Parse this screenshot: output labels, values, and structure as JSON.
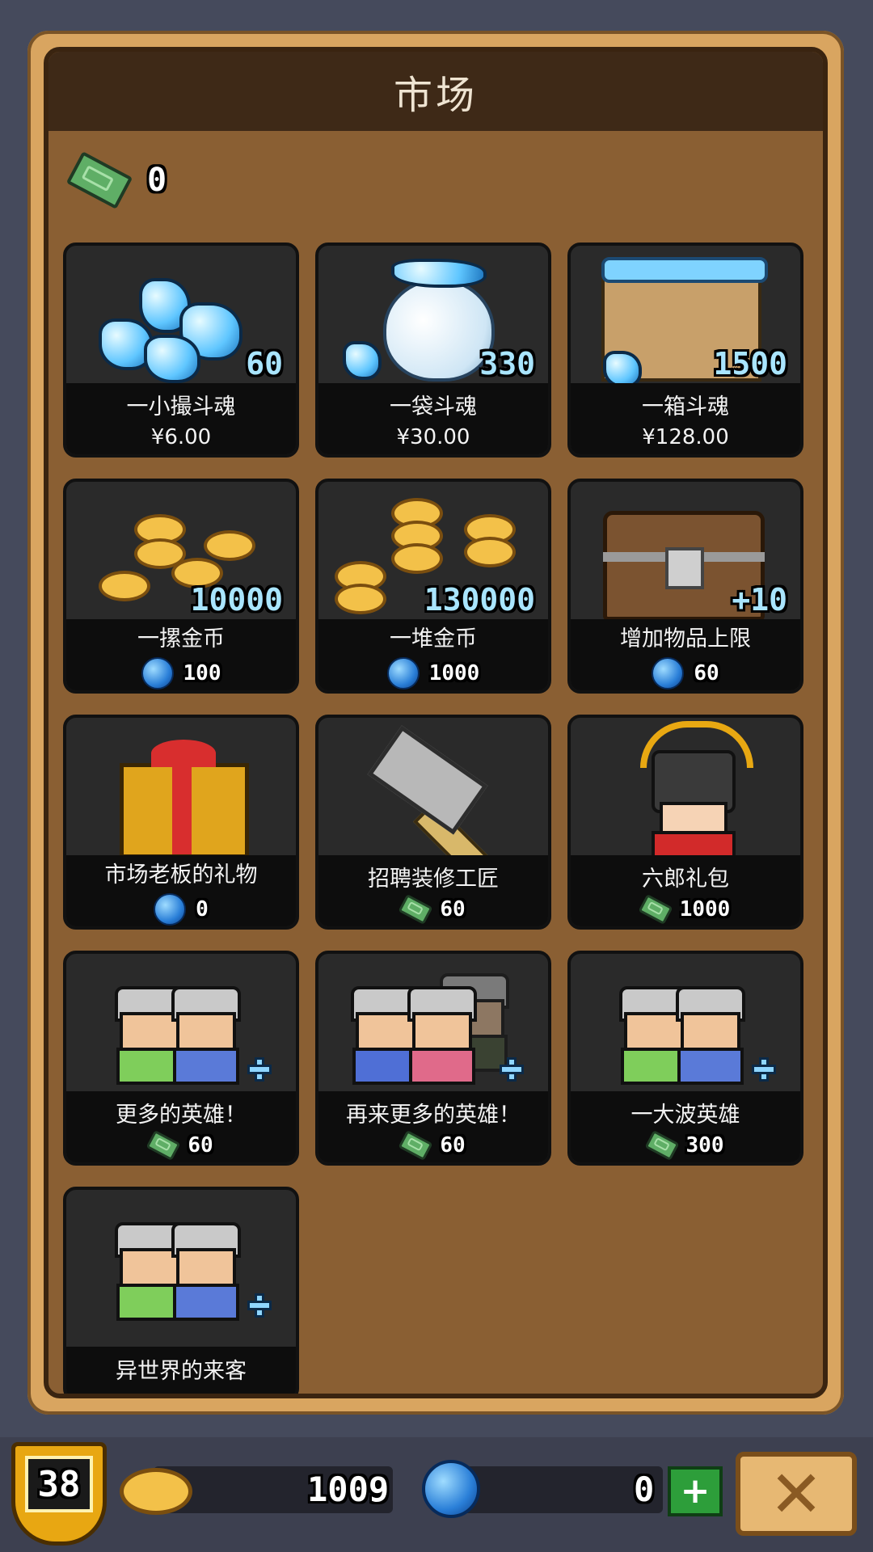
{
  "header": {
    "title": "市场"
  },
  "balance": {
    "icon": "ticket-icon",
    "value": "0"
  },
  "items": [
    {
      "name": "一小撮斗魂",
      "price": "¥6.00",
      "qty": "60",
      "currency": "cash",
      "art": "soul-crystals-small"
    },
    {
      "name": "一袋斗魂",
      "price": "¥30.00",
      "qty": "330",
      "currency": "cash",
      "art": "soul-crystals-bag"
    },
    {
      "name": "一箱斗魂",
      "price": "¥128.00",
      "qty": "1500",
      "currency": "cash",
      "art": "soul-crystals-box"
    },
    {
      "name": "一摞金币",
      "price": "100",
      "qty": "10000",
      "currency": "gem",
      "art": "gold-coins-pile"
    },
    {
      "name": "一堆金币",
      "price": "1000",
      "qty": "130000",
      "currency": "gem",
      "art": "gold-coins-heap"
    },
    {
      "name": "增加物品上限",
      "price": "60",
      "qty": "+10",
      "currency": "gem",
      "art": "treasure-chest"
    },
    {
      "name": "市场老板的礼物",
      "price": "0",
      "qty": "",
      "currency": "gem",
      "art": "gift-box"
    },
    {
      "name": "招聘装修工匠",
      "price": "60",
      "qty": "",
      "currency": "ticket",
      "art": "hammer"
    },
    {
      "name": "六郎礼包",
      "price": "1000",
      "qty": "",
      "currency": "ticket",
      "art": "samurai"
    },
    {
      "name": "更多的英雄！",
      "price": "60",
      "qty": "",
      "currency": "ticket",
      "art": "heroes-two"
    },
    {
      "name": "再来更多的英雄！",
      "price": "60",
      "qty": "",
      "currency": "ticket",
      "art": "heroes-three"
    },
    {
      "name": "一大波英雄",
      "price": "300",
      "qty": "",
      "currency": "ticket",
      "art": "heroes-two"
    },
    {
      "name": "异世界的来客",
      "price": "",
      "qty": "",
      "currency": "ticket",
      "art": "heroes-two"
    }
  ],
  "footer": {
    "level": "38",
    "gold": "1009",
    "gems": "0"
  },
  "colors": {
    "panel": "#8a5f33",
    "title_bar": "#3e2917",
    "card": "#2a2a2a",
    "accent_gold": "#e8a712"
  }
}
